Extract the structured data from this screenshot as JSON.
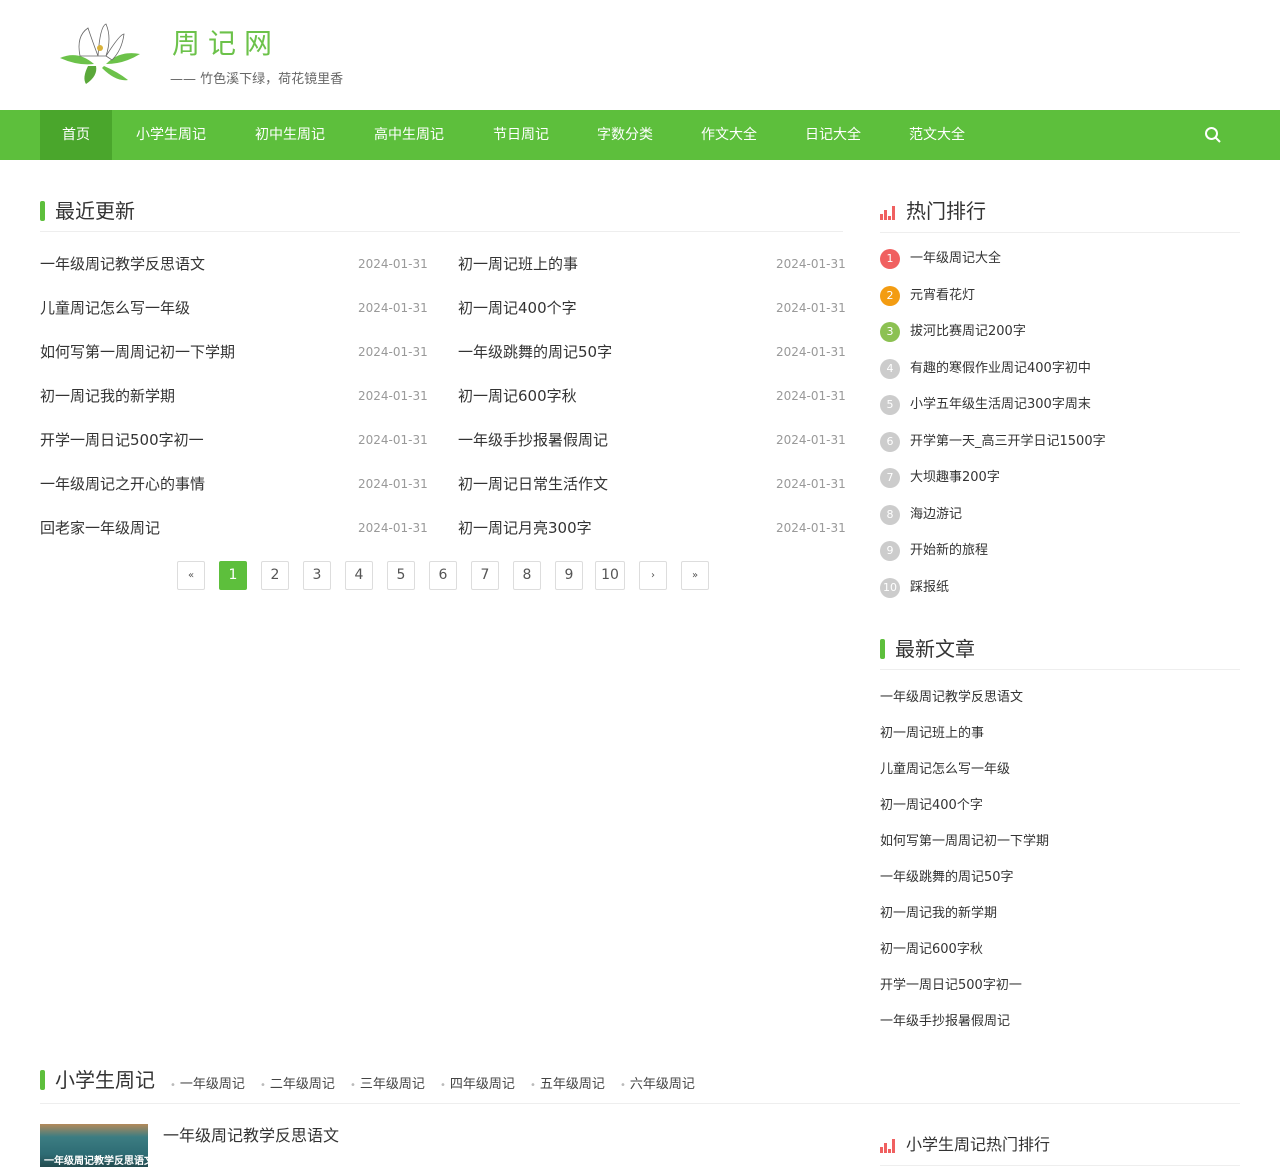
{
  "site": {
    "title": "周记网",
    "slogan": "—— 竹色溪下绿，荷花镜里香"
  },
  "nav": [
    "首页",
    "小学生周记",
    "初中生周记",
    "高中生周记",
    "节日周记",
    "字数分类",
    "作文大全",
    "日记大全",
    "范文大全"
  ],
  "recent": {
    "title": "最近更新",
    "left": [
      {
        "t": "一年级周记教学反思语文",
        "d": "2024-01-31"
      },
      {
        "t": "儿童周记怎么写一年级",
        "d": "2024-01-31"
      },
      {
        "t": "如何写第一周周记初一下学期",
        "d": "2024-01-31"
      },
      {
        "t": "初一周记我的新学期",
        "d": "2024-01-31"
      },
      {
        "t": "开学一周日记500字初一",
        "d": "2024-01-31"
      },
      {
        "t": "一年级周记之开心的事情",
        "d": "2024-01-31"
      },
      {
        "t": "回老家一年级周记",
        "d": "2024-01-31"
      }
    ],
    "right": [
      {
        "t": "初一周记班上的事",
        "d": "2024-01-31"
      },
      {
        "t": "初一周记400个字",
        "d": "2024-01-31"
      },
      {
        "t": "一年级跳舞的周记50字",
        "d": "2024-01-31"
      },
      {
        "t": "初一周记600字秋",
        "d": "2024-01-31"
      },
      {
        "t": "一年级手抄报暑假周记",
        "d": "2024-01-31"
      },
      {
        "t": "初一周记日常生活作文",
        "d": "2024-01-31"
      },
      {
        "t": "初一周记月亮300字",
        "d": "2024-01-31"
      }
    ]
  },
  "pagination": [
    "«",
    "1",
    "2",
    "3",
    "4",
    "5",
    "6",
    "7",
    "8",
    "9",
    "10",
    "›",
    "»"
  ],
  "current_page": 1,
  "hot": {
    "title": "热门排行",
    "items": [
      "一年级周记大全",
      "元宵看花灯",
      "拔河比赛周记200字",
      "有趣的寒假作业周记400字初中",
      "小学五年级生活周记300字周末",
      "开学第一天_高三开学日记1500字",
      "大坝趣事200字",
      "海边游记",
      "开始新的旅程",
      "踩报纸"
    ],
    "colors": [
      "#f06060",
      "#f39c12",
      "#8cc152",
      "#ccc",
      "#ccc",
      "#ccc",
      "#ccc",
      "#ccc",
      "#ccc",
      "#ccc"
    ]
  },
  "latest": {
    "title": "最新文章",
    "items": [
      "一年级周记教学反思语文",
      "初一周记班上的事",
      "儿童周记怎么写一年级",
      "初一周记400个字",
      "如何写第一周周记初一下学期",
      "一年级跳舞的周记50字",
      "初一周记我的新学期",
      "初一周记600字秋",
      "开学一周日记500字初一",
      "一年级手抄报暑假周记"
    ]
  },
  "primary": {
    "title": "小学生周记",
    "subs": [
      "一年级周记",
      "二年级周记",
      "三年级周记",
      "四年级周记",
      "五年级周记",
      "六年级周记"
    ],
    "first_article": "一年级周记教学反思语文",
    "thumb_caption": "一年级周记教学反思语文",
    "hot_title": "小学生周记热门排行"
  }
}
